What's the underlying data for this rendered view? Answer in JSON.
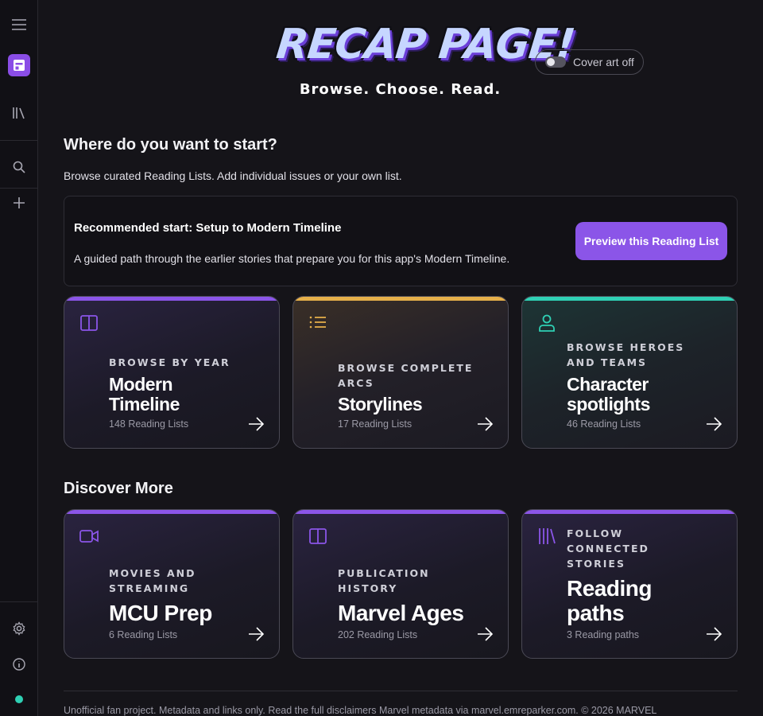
{
  "sidebar": {
    "items": [
      {
        "name": "menu-icon"
      },
      {
        "name": "app-logo-icon"
      },
      {
        "name": "library-icon"
      },
      {
        "name": "search-icon"
      },
      {
        "name": "add-icon"
      },
      {
        "name": "settings-icon"
      },
      {
        "name": "info-icon"
      }
    ],
    "status_color": "#2fd0b4"
  },
  "header": {
    "title": "RECAP PAGE!",
    "tagline": "Browse. Choose. Read.",
    "cover_toggle_label": "Cover art off",
    "cover_toggle_on": false
  },
  "intro": {
    "title": "Where do you want to start?",
    "subtitle": "Browse curated Reading Lists. Add individual issues or your own list."
  },
  "recommended": {
    "title": "Recommended start: Setup to Modern Timeline",
    "description": "A guided path through the earlier stories that prepare you for this app's Modern Timeline.",
    "button_label": "Preview this Reading List"
  },
  "start_cards": [
    {
      "kicker": "Browse by year",
      "title": "Modern Timeline",
      "count": "148 Reading Lists",
      "accent": "#8b55e8",
      "icon": "book-open-icon"
    },
    {
      "kicker": "Browse complete arcs",
      "title": "Storylines",
      "count": "17 Reading Lists",
      "accent": "#e6b04a",
      "icon": "list-icon"
    },
    {
      "kicker": "Browse heroes and teams",
      "title": "Character spotlights",
      "count": "46 Reading Lists",
      "accent": "#2fd0b4",
      "icon": "user-icon"
    }
  ],
  "discover": {
    "title": "Discover More",
    "cards": [
      {
        "kicker": "Movies and streaming",
        "title": "MCU Prep",
        "count": "6 Reading Lists",
        "accent": "#8b55e8",
        "icon": "video-icon"
      },
      {
        "kicker": "Publication history",
        "title": "Marvel Ages",
        "count": "202 Reading Lists",
        "accent": "#8b55e8",
        "icon": "book-open-icon"
      },
      {
        "kicker": "Follow connected stories",
        "title": "Reading paths",
        "count": "3 Reading paths",
        "accent": "#8b55e8",
        "icon": "library-icon"
      }
    ]
  },
  "footer": {
    "text": "Unofficial fan project. Metadata and links only. Read the full disclaimers Marvel metadata via marvel.emreparker.com. © 2026 MARVEL"
  }
}
